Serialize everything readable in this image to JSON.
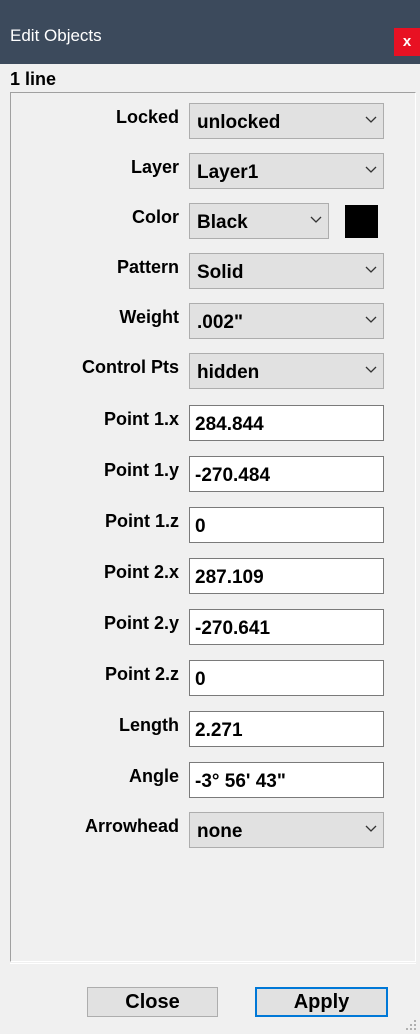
{
  "window": {
    "title": "Edit Objects",
    "close_glyph": "x",
    "subtitle": "1 line"
  },
  "fields": {
    "locked": {
      "label": "Locked",
      "value": "unlocked"
    },
    "layer": {
      "label": "Layer",
      "value": "Layer1"
    },
    "color": {
      "label": "Color",
      "value": "Black",
      "swatch": "#000000"
    },
    "pattern": {
      "label": "Pattern",
      "value": "Solid"
    },
    "weight": {
      "label": "Weight",
      "value": ".002\""
    },
    "control_pts": {
      "label": "Control Pts",
      "value": "hidden"
    },
    "point1x": {
      "label": "Point 1.x",
      "value": "284.844"
    },
    "point1y": {
      "label": "Point 1.y",
      "value": "-270.484"
    },
    "point1z": {
      "label": "Point 1.z",
      "value": "0"
    },
    "point2x": {
      "label": "Point 2.x",
      "value": "287.109"
    },
    "point2y": {
      "label": "Point 2.y",
      "value": "-270.641"
    },
    "point2z": {
      "label": "Point 2.z",
      "value": "0"
    },
    "length": {
      "label": "Length",
      "value": "2.271"
    },
    "angle": {
      "label": "Angle",
      "value": "-3° 56' 43\""
    },
    "arrowhead": {
      "label": "Arrowhead",
      "value": "none"
    }
  },
  "buttons": {
    "close": "Close",
    "apply": "Apply"
  },
  "colors": {
    "titlebar": "#3c4a5c",
    "close_button": "#e81123",
    "default_button_border": "#0078d7"
  },
  "icons": {
    "dropdown": "chevron-down-icon",
    "resize": "resize-grip-icon"
  }
}
